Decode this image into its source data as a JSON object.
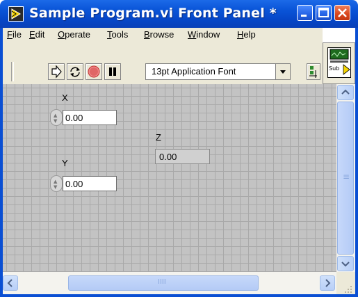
{
  "window": {
    "title": "Sample Program.vi Front Panel *",
    "title_bar_color": "#0a55d8",
    "close_button_color": "#d9451c"
  },
  "menu": {
    "items": [
      {
        "label": "File",
        "underline": "F",
        "rest": "ile"
      },
      {
        "label": "Edit",
        "underline": "E",
        "rest": "dit"
      },
      {
        "label": "Operate",
        "underline": "O",
        "rest": "perate"
      },
      {
        "label": "Tools",
        "underline": "T",
        "rest": "ools"
      },
      {
        "label": "Browse",
        "underline": "B",
        "rest": "rowse"
      },
      {
        "label": "Window",
        "underline": "W",
        "rest": "indow"
      },
      {
        "label": "Help",
        "underline": "H",
        "rest": "elp"
      }
    ]
  },
  "toolbar": {
    "run_icon": "run-arrow-icon",
    "run_continuously_icon": "run-continuously-icon",
    "abort_icon": "abort-icon",
    "pause_icon": "pause-icon",
    "font_select_value": "13pt Application Font",
    "align_icon": "align-objects-icon"
  },
  "vi_icon": {
    "text": "Sub"
  },
  "panel": {
    "grid_color": "#a9a9a9",
    "background_color": "#c3c3c3",
    "controls": {
      "x": {
        "label": "X",
        "value": "0.00"
      },
      "y": {
        "label": "Y",
        "value": "0.00"
      }
    },
    "indicators": {
      "z": {
        "label": "Z",
        "value": "0.00"
      }
    }
  },
  "scrollbars": {
    "h_thumb_grip": "IIII",
    "v_thumb_grip": "≡"
  }
}
